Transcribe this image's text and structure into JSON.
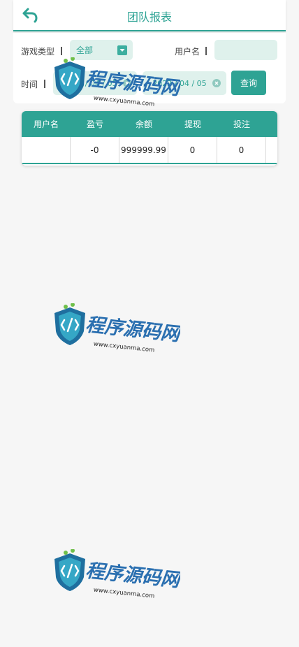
{
  "header": {
    "title": "团队报表"
  },
  "filters": {
    "game_type_label": "游戏类型",
    "game_type_value": "全部",
    "username_label": "用户名",
    "username_value": "",
    "time_label": "时间",
    "start_date": "2022 / 04 / 05",
    "end_date": "2022 / 04 / 05",
    "query_button": "查询"
  },
  "table": {
    "columns": [
      "用户名",
      "盈亏",
      "余额",
      "提现",
      "投注"
    ],
    "rows": [
      [
        "",
        "-0",
        "999999.99",
        "0",
        "0"
      ]
    ]
  },
  "watermark": {
    "brand": "程序源码网",
    "url": "www.cxyuanma.com"
  },
  "colors": {
    "accent": "#2ea394",
    "field_bg": "#dff1ec"
  }
}
